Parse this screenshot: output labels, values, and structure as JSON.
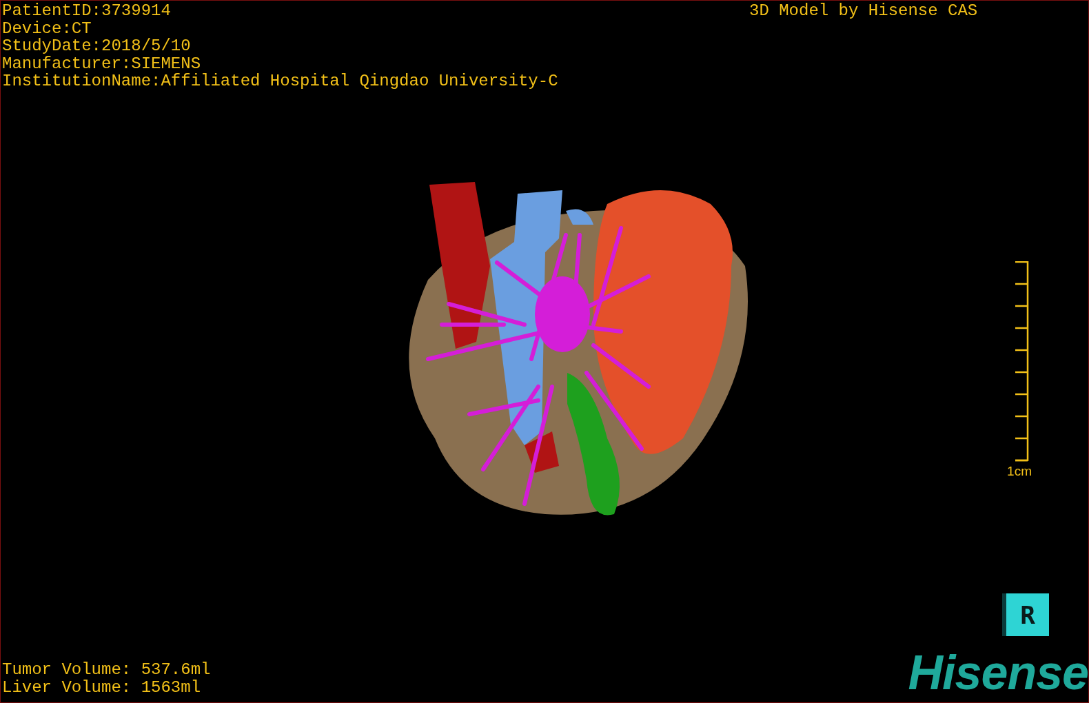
{
  "study_info": [
    "PatientID:3739914",
    "Device:CT",
    "StudyDate:2018/5/10",
    "Manufacturer:SIEMENS",
    "InstitutionName:Affiliated Hospital Qingdao University-C"
  ],
  "title": "3D Model by Hisense CAS",
  "scale_bar": {
    "label": "1cm"
  },
  "volumes": [
    "Tumor Volume: 537.6ml",
    "Liver Volume: 1563ml"
  ],
  "orientation_cube": {
    "label": "R"
  },
  "logo": "Hisense"
}
